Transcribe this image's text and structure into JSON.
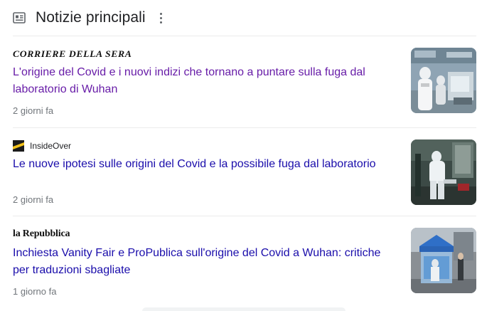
{
  "header": {
    "title": "Notizie principali",
    "icon": "newspaper-icon",
    "menu_icon": "more-vert-icon"
  },
  "stories": [
    {
      "source": "CORRIERE DELLA SERA",
      "headline": "L'origine del Covid e i nuovi indizi che tornano a puntare sulla fuga dal laboratorio di Wuhan",
      "time": "2 giorni fa",
      "visited": true
    },
    {
      "source": "InsideOver",
      "headline": "Le nuove ipotesi sulle origini del Covid e la possibile fuga dal laboratorio",
      "time": "2 giorni fa",
      "visited": false
    },
    {
      "source": "la Repubblica",
      "headline": "Inchiesta Vanity Fair e ProPublica sull'origine del Covid a Wuhan: critiche per traduzioni sbagliate",
      "time": "1 giorno fa",
      "visited": false
    }
  ],
  "colors": {
    "link": "#1a0dab",
    "visited_link": "#681da8",
    "meta_text": "#70757a",
    "divider": "#ebebeb"
  }
}
